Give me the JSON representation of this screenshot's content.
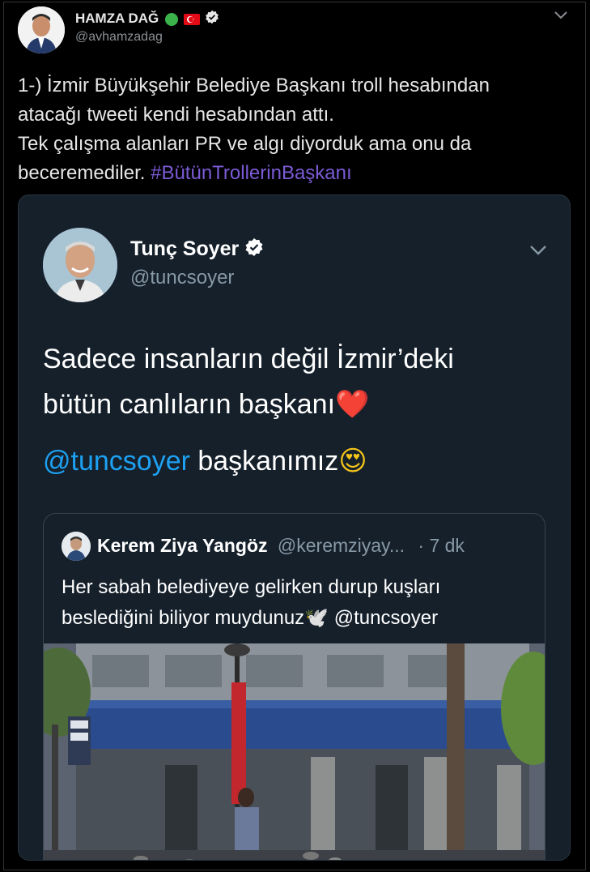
{
  "outer_tweet": {
    "author_name": "HAMZA DAĞ",
    "author_handle": "@avhamzadag",
    "text_line1": "1-) İzmir Büyükşehir Belediye Başkanı troll hesabından",
    "text_line2": "atacağı tweeti kendi hesabından attı.",
    "text_line3": "Tek çalışma alanları PR ve algı diyorduk ama onu da",
    "text_line4_prefix": "beceremediler. ",
    "hashtag": "#BütünTrollerinBaşkanı"
  },
  "embedded_tweet": {
    "author_name": "Tunç Soyer",
    "author_handle": "@tuncsoyer",
    "line1": "Sadece insanların değil İzmir’deki",
    "line2": "bütün canlıların başkanı",
    "line2_emoji": "❤️",
    "mention": "@tuncsoyer",
    "line3_rest": " başkanımız",
    "line3_emoji": "😍"
  },
  "quoted_tweet": {
    "author_name": "Kerem Ziya Yangöz",
    "author_handle": "@keremziyay...",
    "time": "· 7 dk",
    "line1": "Her sabah belediyeye gelirken durup kuşları",
    "line2_prefix": "beslediğini biliyor muydunuz",
    "line2_emoji": "🕊️",
    "mention": "@tuncsoyer"
  },
  "colors": {
    "background": "#000000",
    "card": "#15202b",
    "link": "#1da1f2",
    "verified": "#ffffff"
  }
}
